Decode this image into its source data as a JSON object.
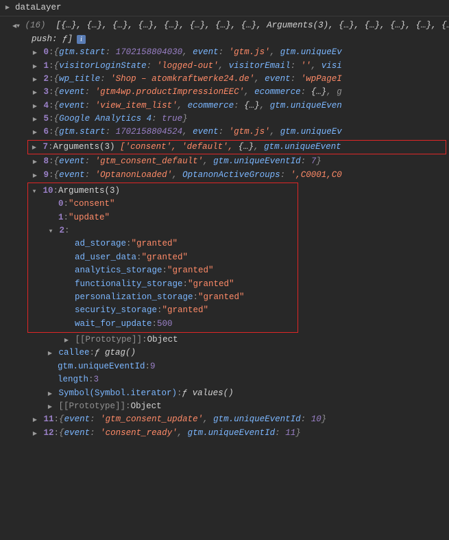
{
  "header": {
    "label": "dataLayer"
  },
  "summary": {
    "count": "(16)",
    "frag1": "[{…}, {…}, {…}, {…}, {…}, {…}, {…}, {…}, ",
    "args": "Arguments(3)",
    "frag2": ", {…}, {…}, {…}, {…}, {…}, ",
    "push": "push: ƒ",
    "close": "]"
  },
  "rows": {
    "r0": {
      "idx": "0",
      "k1": "gtm.start",
      "v1": "1702158804030",
      "k2": "event",
      "v2": "'gtm.js'",
      "k3": "gtm.uniqueEv"
    },
    "r1": {
      "idx": "1",
      "k1": "visitorLoginState",
      "v1": "'logged-out'",
      "k2": "visitorEmail",
      "v2": "''",
      "k3": "visi"
    },
    "r2": {
      "idx": "2",
      "k1": "wp_title",
      "v1": "'Shop – atomkraftwerke24.de'",
      "k2": "event",
      "v2": "'wpPageI"
    },
    "r3": {
      "idx": "3",
      "k1": "event",
      "v1": "'gtm4wp.productImpressionEEC'",
      "k2": "ecommerce",
      "v2": "{…}",
      "tail": ", g"
    },
    "r4": {
      "idx": "4",
      "k1": "event",
      "v1": "'view_item_list'",
      "k2": "ecommerce",
      "v2": "{…}",
      "k3": "gtm.uniqueEven"
    },
    "r5": {
      "idx": "5",
      "k1": "Google Analytics 4",
      "v1": "true"
    },
    "r6": {
      "idx": "6",
      "k1": "gtm.start",
      "v1": "1702158804524",
      "k2": "event",
      "v2": "'gtm.js'",
      "k3": "gtm.uniqueEv"
    },
    "r7": {
      "idx": "7",
      "label": "Arguments(3)",
      "arr": "['consent', 'default', ",
      "obj": "{…}",
      "tail": "gtm.uniqueEvent"
    },
    "r8": {
      "idx": "8",
      "k1": "event",
      "v1": "'gtm_consent_default'",
      "k2": "gtm.uniqueEventId",
      "v2": "7"
    },
    "r9": {
      "idx": "9",
      "k1": "event",
      "v1": "'OptanonLoaded'",
      "k2": "OptanonActiveGroups",
      "v2": "',C0001,C0"
    },
    "r10": {
      "idx": "10",
      "label": "Arguments(3)"
    },
    "r10_0": {
      "idx": "0",
      "v": "\"consent\""
    },
    "r10_1": {
      "idx": "1",
      "v": "\"update\""
    },
    "r10_2": {
      "idx": "2"
    },
    "consent": {
      "ad_storage": "\"granted\"",
      "ad_user_data": "\"granted\"",
      "analytics_storage": "\"granted\"",
      "functionality_storage": "\"granted\"",
      "personalization_storage": "\"granted\"",
      "security_storage": "\"granted\"",
      "wait_for_update": "500"
    },
    "proto1": {
      "k": "[[Prototype]]",
      "v": "Object"
    },
    "callee": {
      "k": "callee",
      "v": "ƒ gtag()"
    },
    "uevt": {
      "k": "gtm.uniqueEventId",
      "v": "9"
    },
    "len": {
      "k": "length",
      "v": "3"
    },
    "symit": {
      "k": "Symbol(Symbol.iterator)",
      "v": "ƒ values()"
    },
    "proto2": {
      "k": "[[Prototype]]",
      "v": "Object"
    },
    "r11": {
      "idx": "11",
      "k1": "event",
      "v1": "'gtm_consent_update'",
      "k2": "gtm.uniqueEventId",
      "v2": "10"
    },
    "r12": {
      "idx": "12",
      "k1": "event",
      "v1": "'consent_ready'",
      "k2": "gtm.uniqueEventId",
      "v2": "11"
    }
  },
  "labels": {
    "ad_storage": "ad_storage",
    "ad_user_data": "ad_user_data",
    "analytics_storage": "analytics_storage",
    "functionality_storage": "functionality_storage",
    "personalization_storage": "personalization_storage",
    "security_storage": "security_storage",
    "wait_for_update": "wait_for_update"
  }
}
